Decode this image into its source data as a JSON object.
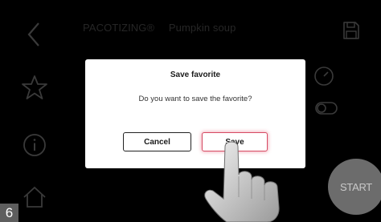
{
  "header": {
    "brand": "PACOTIZING®",
    "recipe": "Pumpkin soup"
  },
  "icons": {
    "back": "back-chevron-icon",
    "favorite": "star-icon",
    "info": "info-icon",
    "home": "home-icon",
    "save": "save-icon",
    "speed": "gauge-icon",
    "toggle": "toggle-icon"
  },
  "dialog": {
    "title": "Save favorite",
    "message": "Do you want to save the favorite?",
    "cancel_label": "Cancel",
    "save_label": "Save"
  },
  "start_button": {
    "label": "START"
  },
  "step_badge": {
    "number": "6"
  },
  "colors": {
    "background": "#000000",
    "dimmed_ui": "#333333",
    "dialog_bg": "#ffffff",
    "save_highlight": "#d64a63",
    "start_button": "#6c6c6c"
  }
}
